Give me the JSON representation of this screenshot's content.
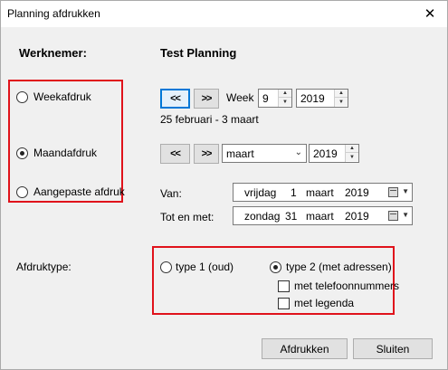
{
  "window": {
    "title": "Planning afdrukken",
    "close_glyph": "✕"
  },
  "labels": {
    "werknemer": "Werknemer:",
    "planning_name": "Test Planning",
    "week": "Week",
    "week_range": "25 februari - 3 maart",
    "van": "Van:",
    "tot_en_met": "Tot en met:",
    "afdruktype": "Afdruktype:"
  },
  "print_mode": {
    "options": [
      {
        "label": "Weekafdruk",
        "checked": false
      },
      {
        "label": "Maandafdruk",
        "checked": true
      },
      {
        "label": "Aangepaste afdruk",
        "checked": false
      }
    ]
  },
  "week_nav": {
    "prev_label": "<<",
    "next_label": ">>",
    "week_value": "9",
    "year_value": "2019"
  },
  "month_nav": {
    "prev_label": "<<",
    "next_label": ">>",
    "month_value": "maart",
    "year_value": "2019"
  },
  "date_from": {
    "weekday": "vrijdag",
    "day": "1",
    "month": "maart",
    "year": "2019"
  },
  "date_to": {
    "weekday": "zondag",
    "day": "31",
    "month": "maart",
    "year": "2019"
  },
  "print_type": {
    "type1": {
      "label": "type 1 (oud)",
      "checked": false
    },
    "type2": {
      "label": "type 2 (met adressen)",
      "checked": true
    },
    "with_phone": {
      "label": "met telefoonnummers",
      "checked": false
    },
    "with_legend": {
      "label": "met legenda",
      "checked": false
    }
  },
  "buttons": {
    "print": "Afdrukken",
    "close": "Sluiten"
  },
  "colors": {
    "highlight_border": "#e0121b",
    "focus_border": "#0078d7"
  }
}
